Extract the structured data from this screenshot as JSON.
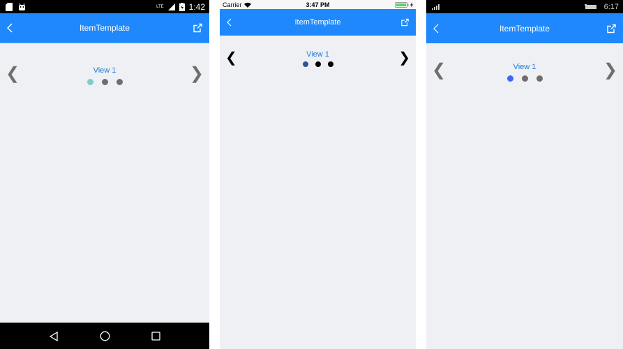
{
  "title": "ItemTemplate",
  "panels": {
    "android": {
      "status": {
        "network": "LTE",
        "time": "1:42"
      },
      "nav_title": "ItemTemplate",
      "carousel": {
        "label": "View 1",
        "prev_arrow": "❮",
        "next_arrow": "❯",
        "selected_index": 0,
        "dot_count": 3
      },
      "colors": {
        "dot_active": "#7fcdc6",
        "dot_inactive": "#6e6e6e",
        "arrow": "#6e6e6e"
      },
      "sysnav": {
        "back": "◁",
        "home": "○",
        "recents": "□"
      }
    },
    "ios": {
      "status": {
        "carrier": "Carrier",
        "time": "3:47 PM"
      },
      "nav_title": "ItemTemplate",
      "carousel": {
        "label": "View 1",
        "prev_arrow": "❮",
        "next_arrow": "❯",
        "selected_index": 0,
        "dot_count": 3
      },
      "colors": {
        "dot_active": "#2f5597",
        "dot_inactive": "#000000",
        "arrow": "#000000"
      }
    },
    "uwp": {
      "status": {
        "time": "6:17"
      },
      "nav_title": "ItemTemplate",
      "carousel": {
        "label": "View 1",
        "prev_arrow": "❮",
        "next_arrow": "❯",
        "selected_index": 0,
        "dot_count": 3
      },
      "colors": {
        "dot_active": "#3d68f0",
        "dot_inactive": "#6e6e6e",
        "arrow": "#6e6e6e"
      }
    }
  },
  "colors": {
    "navbar": "#1e88fc",
    "background": "#eff0f4",
    "label": "#1a7bd6"
  }
}
